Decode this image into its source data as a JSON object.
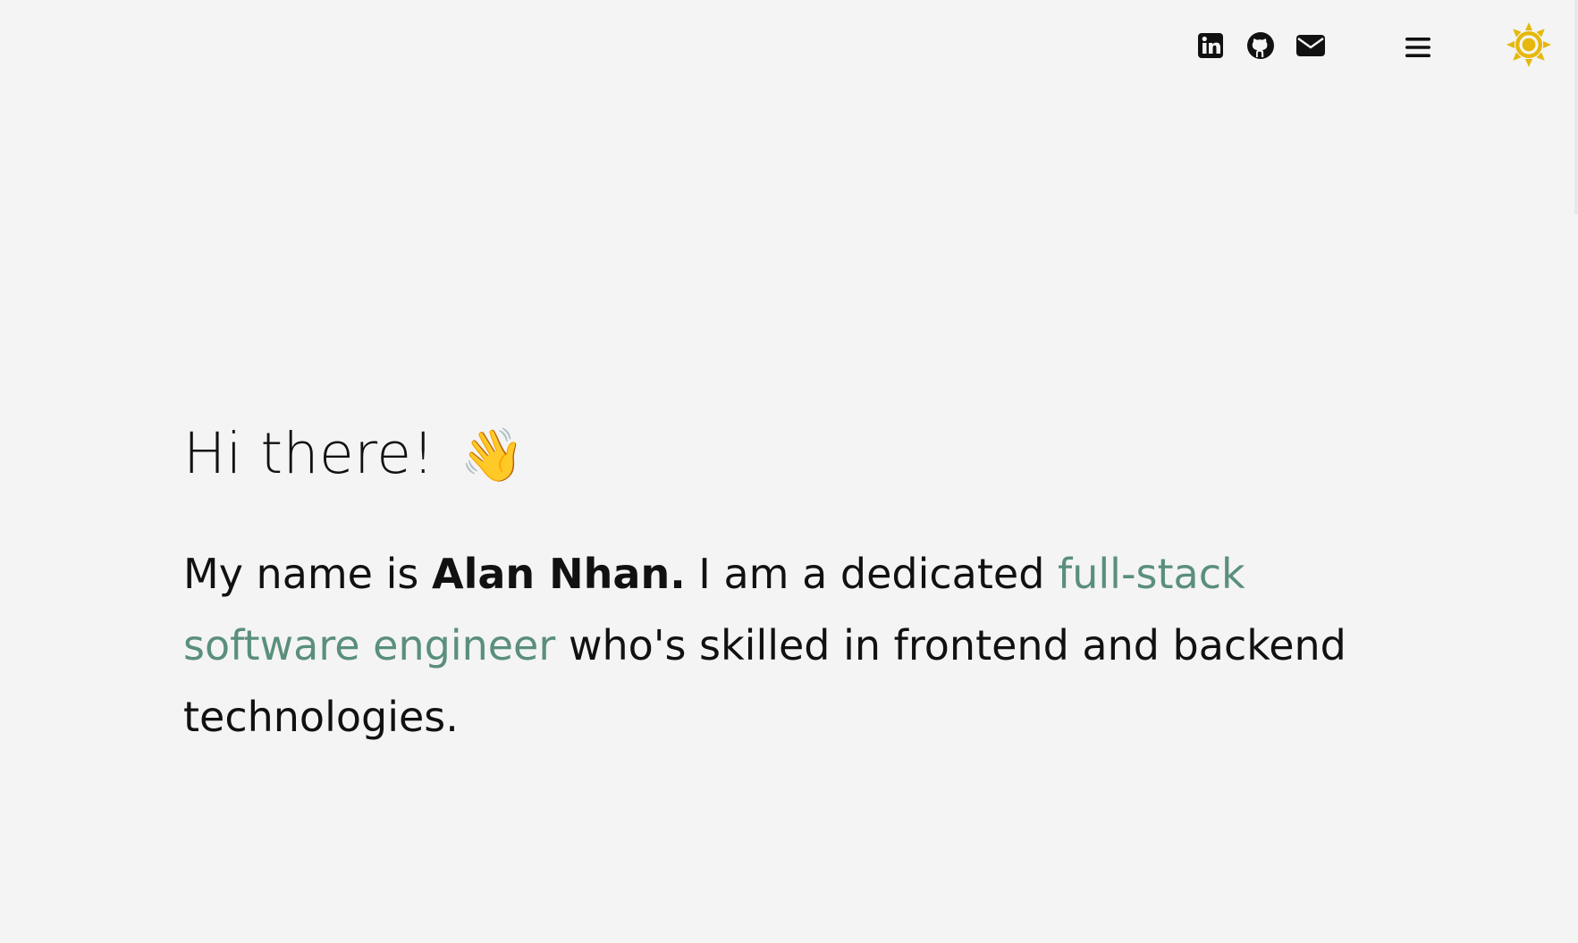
{
  "nav": {
    "icons": {
      "linkedin": "linkedin-icon",
      "github": "github-icon",
      "email": "mail-icon",
      "menu": "hamburger-menu-icon",
      "theme": "sun-icon"
    },
    "colors": {
      "icon": "#111111",
      "sun": "#e5b80b"
    }
  },
  "hero": {
    "greeting": "Hi there!",
    "wave_emoji": "👋",
    "intro_prefix": "My name is ",
    "name": "Alan Nhan.",
    "intro_middle": " I am a dedicated ",
    "role": "full-stack software engineer",
    "intro_suffix": " who's skilled in frontend and backend technologies."
  },
  "colors": {
    "background": "#f4f4f4",
    "text": "#111111",
    "accent": "#5a8f7b"
  }
}
